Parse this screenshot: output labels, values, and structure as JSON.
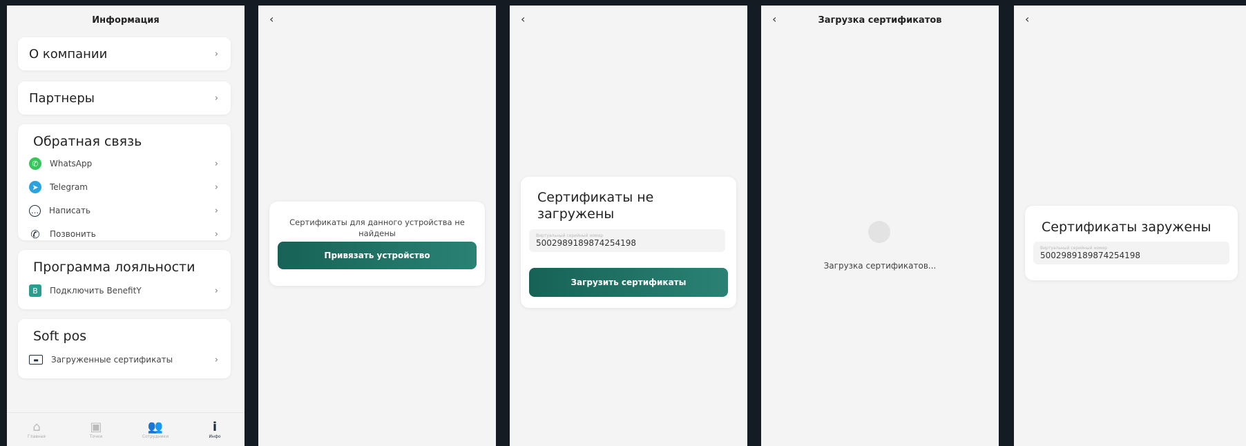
{
  "info_screen": {
    "title": "Информация",
    "rows": {
      "about": "О компании",
      "partners": "Партнеры"
    },
    "feedback": {
      "title": "Обратная связь",
      "items": [
        "WhatsApp",
        "Telegram",
        "Написать",
        "Позвонить"
      ]
    },
    "loyalty": {
      "title": "Программа лояльности",
      "items": [
        "Подключить BenefitY"
      ]
    },
    "softpos": {
      "title": "Soft pos",
      "items": [
        "Загруженные сертификаты"
      ]
    },
    "chevron": "›",
    "tabs": [
      {
        "icon": "⌂",
        "label": "Главная"
      },
      {
        "icon": "▣",
        "label": "Точки"
      },
      {
        "icon": "👥",
        "label": "Сотрудники"
      },
      {
        "icon": "i",
        "label": "Инфо"
      }
    ],
    "colors": {
      "whatsapp": "#34c759",
      "telegram": "#2aa3de",
      "accent": "#1f6e63"
    }
  },
  "back_glyph": "‹",
  "screen2": {
    "message": "Сертификаты для данного устройства не найдены",
    "button": "Привязать устройство"
  },
  "screen3": {
    "title": "Сертификаты не загружены",
    "serial_label": "Виртуальный серийный номер",
    "serial": "5002989189874254198",
    "button": "Загрузить сертификаты"
  },
  "screen4": {
    "title": "Загрузка сертификатов",
    "status": "Загрузка сертификатов..."
  },
  "screen5": {
    "title": "Сертификаты заружены",
    "serial_label": "Виртуальный серийный номер",
    "serial": "5002989189874254198"
  }
}
